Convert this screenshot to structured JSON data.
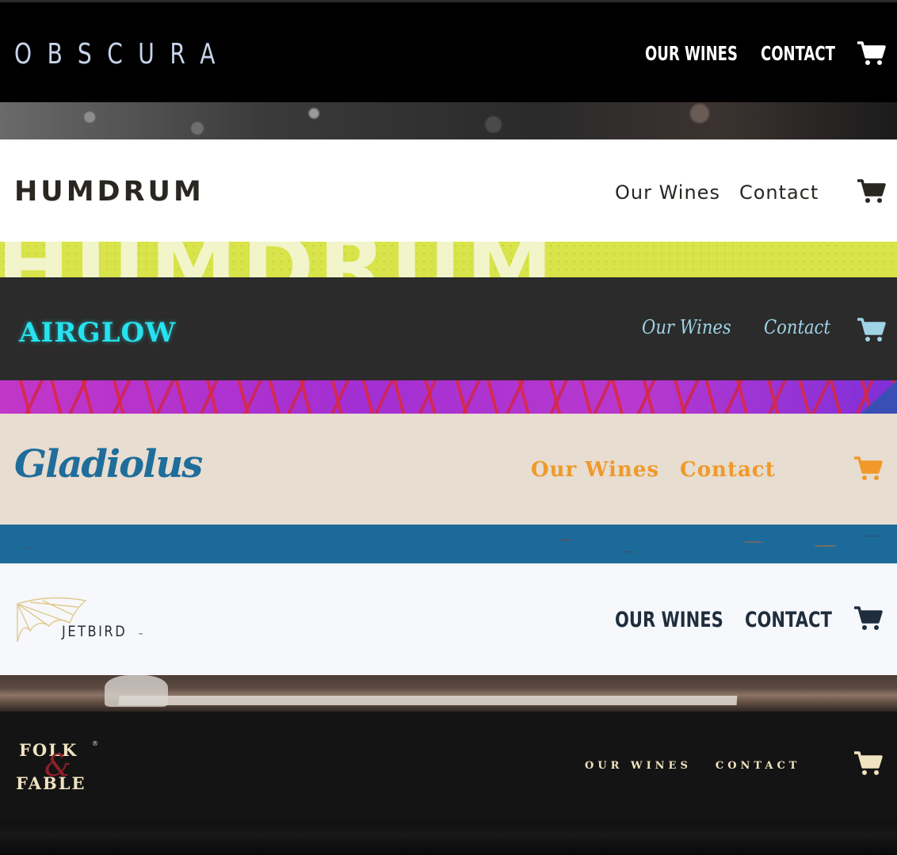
{
  "headers": [
    {
      "brand": "OBSCURA",
      "nav": [
        "OUR WINES",
        "CONTACT"
      ],
      "icon": "cart-icon",
      "colors": {
        "background": "#000000",
        "logo": "#c7d3ea",
        "nav": "#ffffff"
      }
    },
    {
      "brand": "HUMDRUM",
      "nav": [
        "Our Wines",
        "Contact"
      ],
      "icon": "cart-icon",
      "banner_text": "HUMDRUM",
      "colors": {
        "background": "#ffffff",
        "logo": "#2a2622",
        "nav": "#2a2622",
        "banner": "#d9e34a"
      }
    },
    {
      "brand": "AIRGLOW",
      "nav": [
        "Our Wines",
        "Contact"
      ],
      "icon": "cart-icon",
      "colors": {
        "background": "#2b2b2b",
        "logo": "#27e2ef",
        "nav": "#9fd3e6"
      }
    },
    {
      "brand": "Gladiolus",
      "nav": [
        "Our Wines",
        "Contact"
      ],
      "icon": "cart-icon",
      "colors": {
        "background": "#e7ddd0",
        "logo": "#1f6d9a",
        "nav": "#f0992a"
      }
    },
    {
      "brand": "JETBIRD",
      "brand_mark": "™",
      "nav": [
        "OUR WINES",
        "CONTACT"
      ],
      "icon": "cart-icon",
      "colors": {
        "background": "#f6f8fb",
        "logo": "#2b2f38",
        "nav": "#1f2d3d",
        "wing": "#e0c98c"
      }
    },
    {
      "brand_line1": "FOLK",
      "brand_amp": "&",
      "brand_line2": "FABLE",
      "brand_mark": "®",
      "nav": [
        "OUR WINES",
        "CONTACT"
      ],
      "icon": "cart-icon",
      "colors": {
        "background": "#141414",
        "logo": "#f0e3bf",
        "nav": "#f0e3bf",
        "amp": "#8f1f2a"
      }
    }
  ]
}
